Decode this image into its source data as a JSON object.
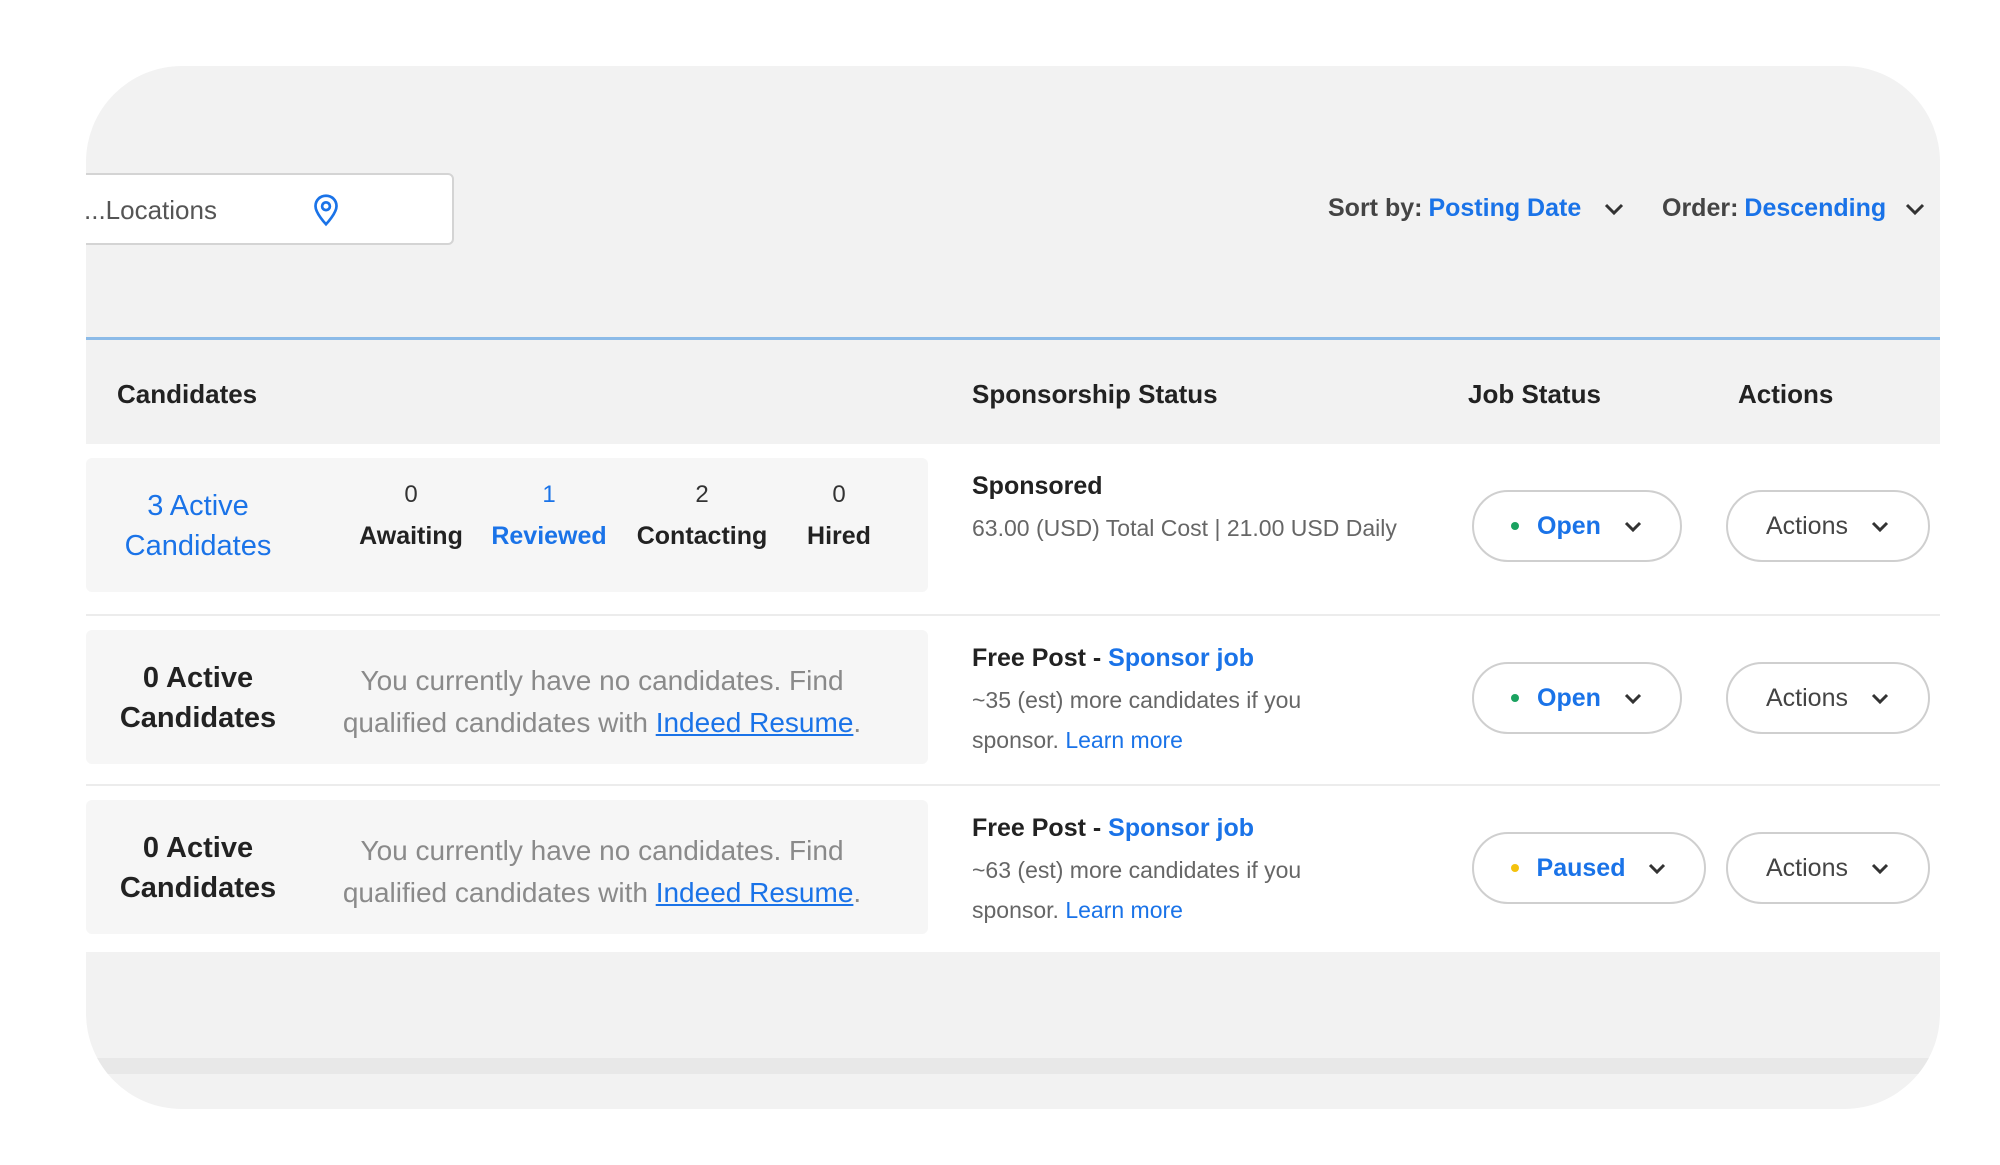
{
  "search": {
    "placeholder": "Locations..."
  },
  "sort": {
    "label": "Sort by:",
    "value": "Posting Date"
  },
  "order": {
    "label": "Order:",
    "value": "Descending"
  },
  "columns": {
    "candidates": "Candidates",
    "sponsorship": "Sponsorship Status",
    "job_status": "Job Status",
    "actions": "Actions"
  },
  "rows": [
    {
      "active_count": "3 Active",
      "active_label": "Candidates",
      "stats": [
        {
          "value": "0",
          "label": "Awaiting"
        },
        {
          "value": "1",
          "label": "Reviewed"
        },
        {
          "value": "2",
          "label": "Contacting"
        },
        {
          "value": "0",
          "label": "Hired"
        }
      ],
      "sponsorship_title": "Sponsored",
      "sponsorship_detail": "63.00 (USD) Total Cost | 21.00 USD Daily",
      "job_status": "Open",
      "actions": "Actions"
    },
    {
      "active_count": "0 Active",
      "active_label": "Candidates",
      "empty_text": "You currently have no candidates. Find qualified candidates with",
      "empty_link": "Indeed Resume",
      "sponsorship_title": "Free Post - ",
      "sponsorship_link": "Sponsor job",
      "sponsorship_detail": "~35 (est) more candidates if you",
      "sponsorship_detail2": "sponsor.",
      "learn_more": "Learn more",
      "job_status": "Open",
      "actions": "Actions"
    },
    {
      "active_count": "0 Active",
      "active_label": "Candidates",
      "empty_text": "You currently have no candidates. Find qualified candidates with",
      "empty_link": "Indeed Resume",
      "sponsorship_title": "Free Post - ",
      "sponsorship_link": "Sponsor job",
      "sponsorship_detail": "~63 (est) more candidates if you",
      "sponsorship_detail2": "sponsor.",
      "learn_more": "Learn more",
      "job_status": "Paused",
      "actions": "Actions"
    }
  ],
  "colors": {
    "accent": "#1a73e8",
    "open_dot": "#1aa260",
    "paused_dot": "#f4c20d"
  },
  "icons": {
    "search": "location-pin-icon",
    "dropdown": "chevron-down-icon"
  }
}
